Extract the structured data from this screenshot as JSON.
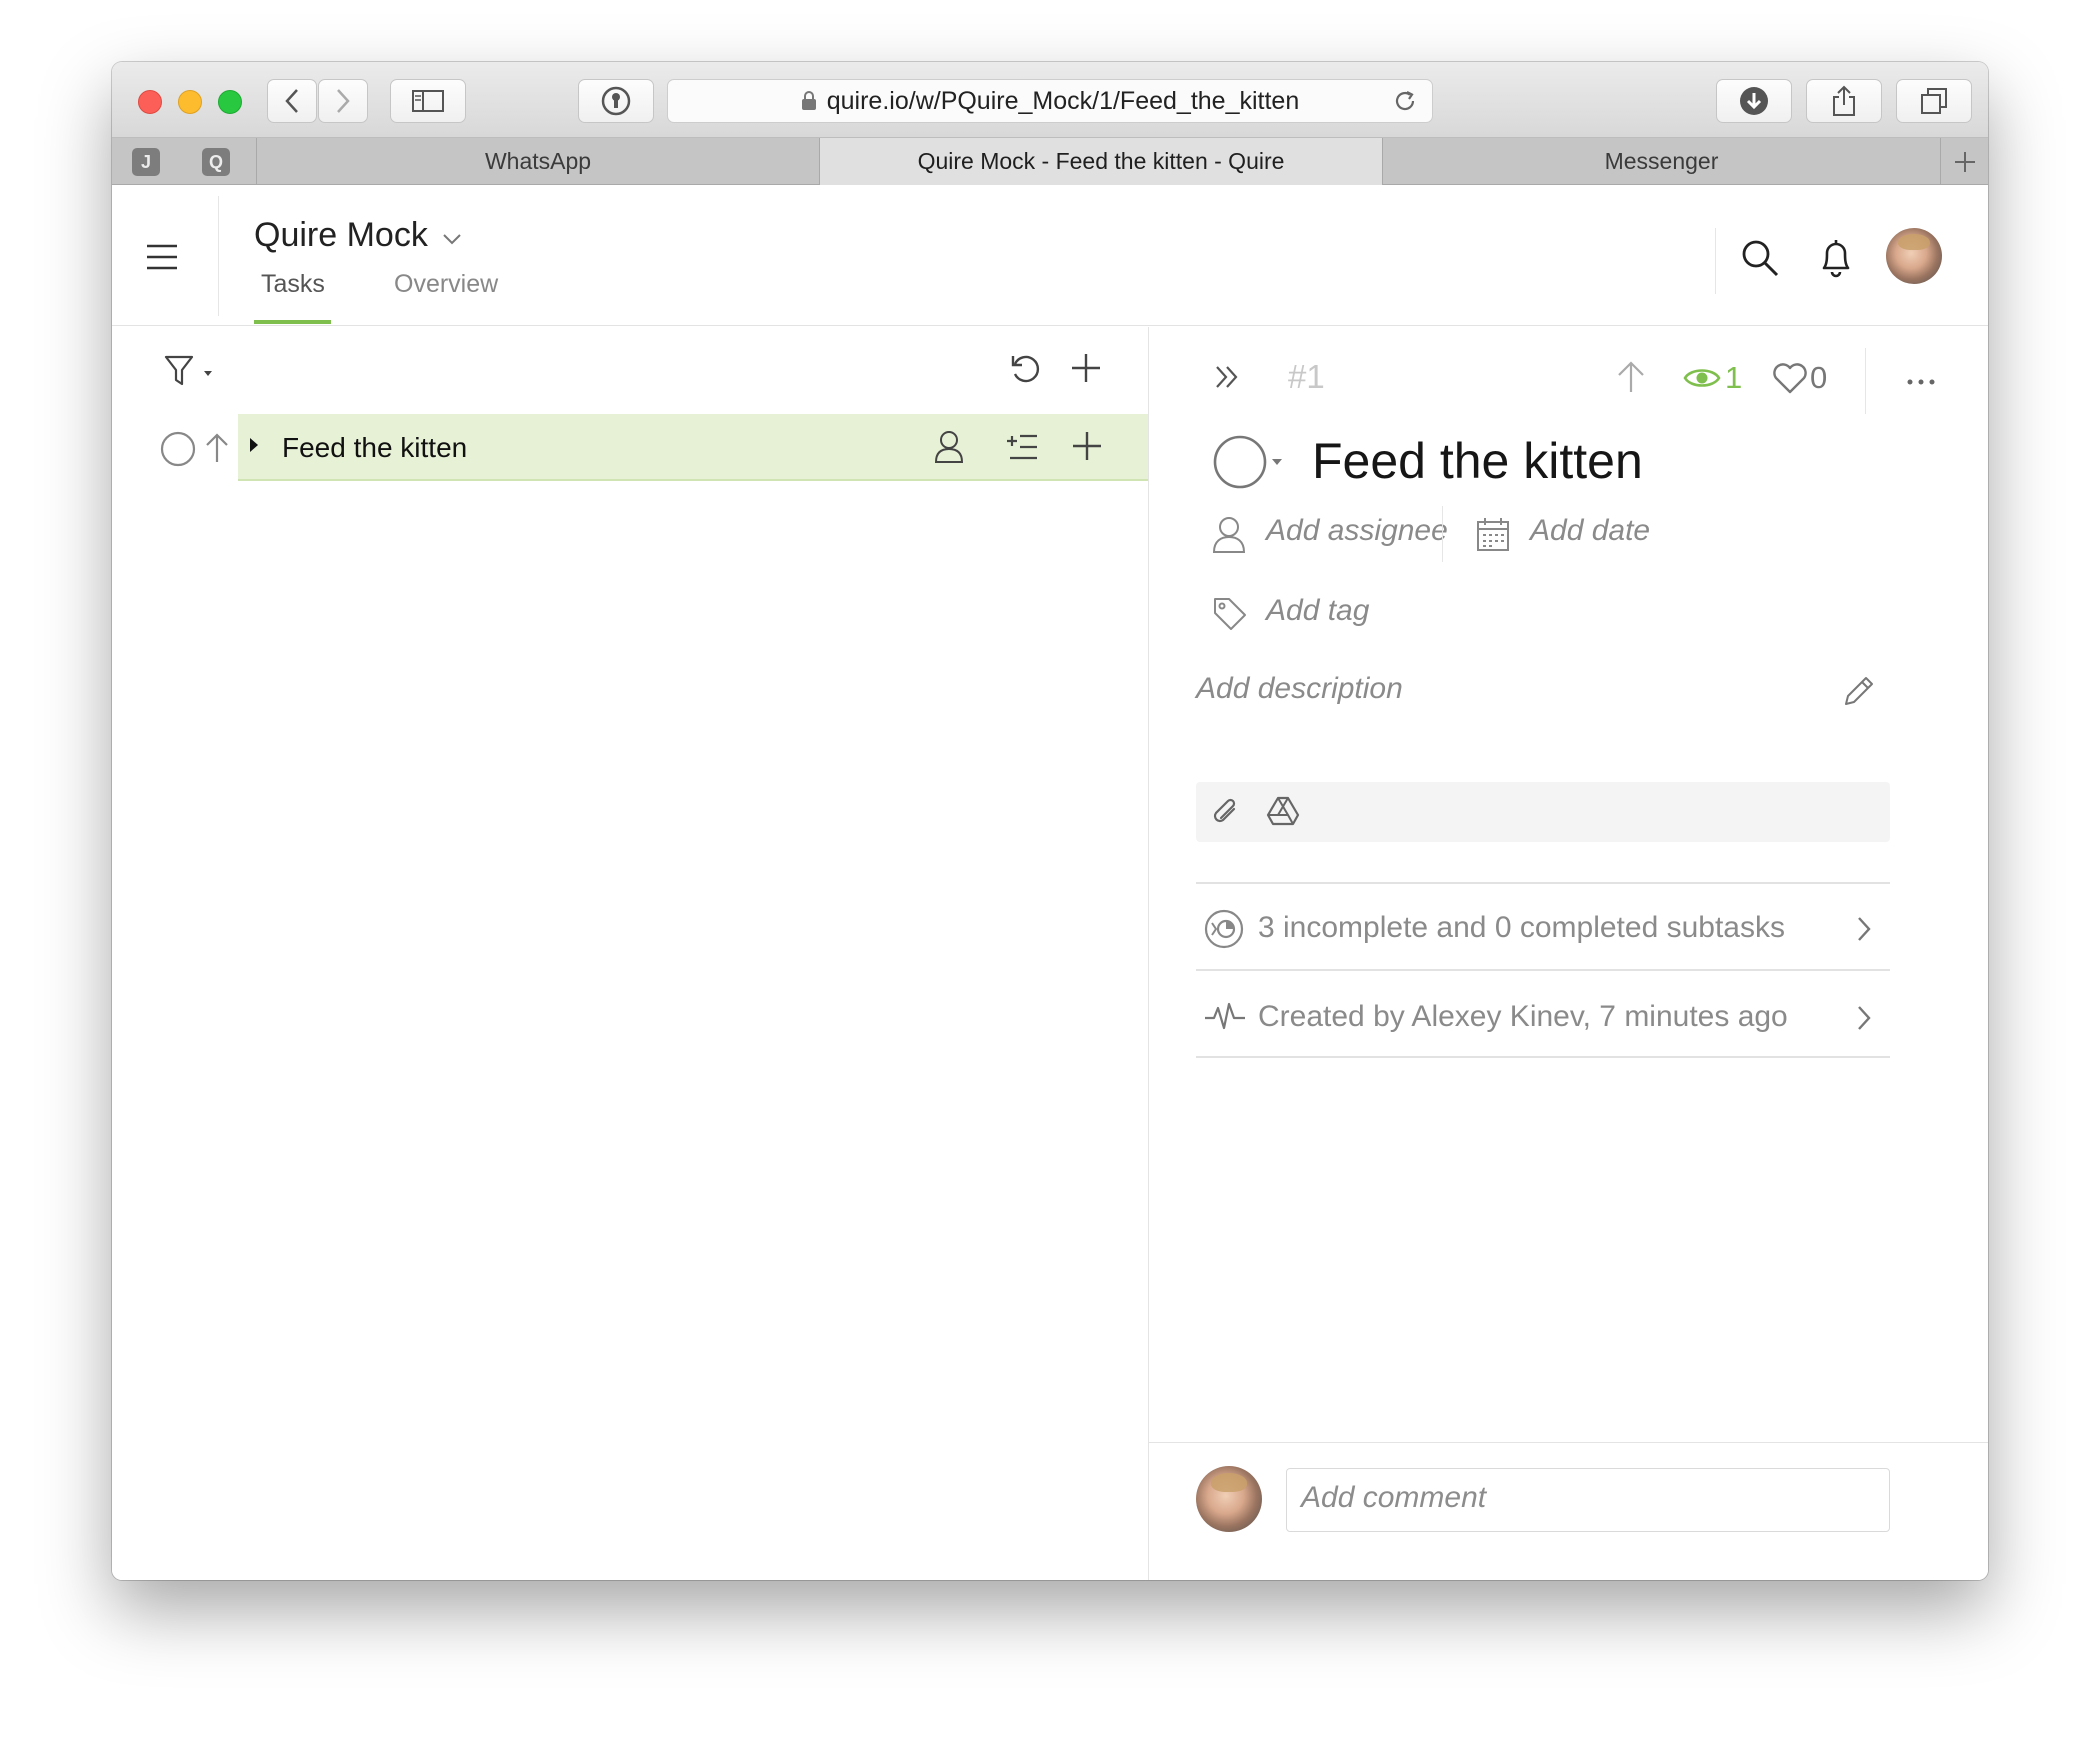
{
  "browser": {
    "url": "quire.io/w/PQuire_Mock/1/Feed_the_kitten",
    "pinned_tabs": [
      "J",
      "Q"
    ],
    "tabs": [
      {
        "label": "WhatsApp",
        "active": false
      },
      {
        "label": "Quire Mock - Feed the kitten - Quire",
        "active": true
      },
      {
        "label": "Messenger",
        "active": false
      }
    ]
  },
  "header": {
    "project_title": "Quire Mock",
    "nav_tabs": [
      {
        "label": "Tasks",
        "active": true
      },
      {
        "label": "Overview",
        "active": false
      }
    ],
    "accent_color": "#7fbf4d"
  },
  "task_list": {
    "tasks": [
      {
        "name": "Feed the kitten",
        "selected": true
      }
    ]
  },
  "detail": {
    "task_number": "#1",
    "watchers_count": "1",
    "likes_count": "0",
    "title": "Feed the kitten",
    "add_assignee": "Add assignee",
    "add_date": "Add date",
    "add_tag": "Add tag",
    "add_description": "Add description",
    "subtasks_summary": "3 incomplete and 0 completed subtasks",
    "activity": "Created by Alexey Kinev, 7 minutes ago",
    "comment_placeholder": "Add comment"
  },
  "icons": [
    "hamburger-icon",
    "search-icon",
    "bell-icon",
    "filter-icon",
    "undo-icon",
    "plus-icon",
    "eye-icon",
    "heart-icon",
    "paperclip-icon",
    "google-drive-icon",
    "pencil-icon",
    "calendar-icon",
    "tag-icon",
    "person-icon"
  ]
}
